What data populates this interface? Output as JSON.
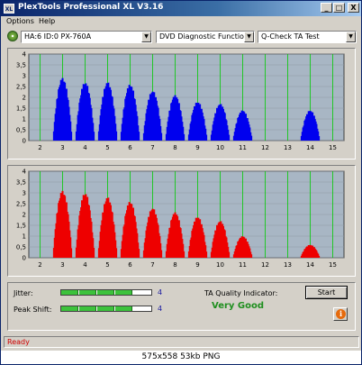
{
  "window": {
    "title": "PlexTools Professional XL V3.16",
    "icon_label": "XL",
    "minimize": "_",
    "maximize": "□",
    "close": "X"
  },
  "menu": {
    "items": [
      "Options",
      "Help"
    ]
  },
  "toolbar": {
    "drive": "HA:6 ID:0  PX-760A",
    "function": "DVD Diagnostic Functions",
    "test": "Q-Check TA Test"
  },
  "chart_data": [
    {
      "type": "bar",
      "name_hint": "top",
      "color": "#0000ee",
      "x_ticks": [
        "2",
        "3",
        "4",
        "5",
        "6",
        "7",
        "8",
        "9",
        "10",
        "11",
        "12",
        "13",
        "14",
        "15"
      ],
      "y_ticks": [
        "0",
        "0,5",
        "1",
        "1,5",
        "2",
        "2,5",
        "3",
        "3,5",
        "4"
      ],
      "xlim": [
        1.5,
        15.5
      ],
      "ylim": [
        0,
        4
      ],
      "grid_color": "#00cc00",
      "peaks": [
        {
          "x": 3,
          "y": 2.9
        },
        {
          "x": 4,
          "y": 2.7
        },
        {
          "x": 5,
          "y": 2.7
        },
        {
          "x": 6,
          "y": 2.6
        },
        {
          "x": 7,
          "y": 2.3
        },
        {
          "x": 8,
          "y": 2.1
        },
        {
          "x": 9,
          "y": 1.8
        },
        {
          "x": 10,
          "y": 1.7
        },
        {
          "x": 11,
          "y": 1.4
        },
        {
          "x": 14,
          "y": 1.4
        }
      ]
    },
    {
      "type": "bar",
      "name_hint": "bottom",
      "color": "#ee0000",
      "x_ticks": [
        "2",
        "3",
        "4",
        "5",
        "6",
        "7",
        "8",
        "9",
        "10",
        "11",
        "12",
        "13",
        "14",
        "15"
      ],
      "y_ticks": [
        "0",
        "0,5",
        "1",
        "1,5",
        "2",
        "2,5",
        "3",
        "3,5",
        "4"
      ],
      "xlim": [
        1.5,
        15.5
      ],
      "ylim": [
        0,
        4
      ],
      "grid_color": "#00cc00",
      "peaks": [
        {
          "x": 3,
          "y": 3.1
        },
        {
          "x": 4,
          "y": 3.0
        },
        {
          "x": 5,
          "y": 2.8
        },
        {
          "x": 6,
          "y": 2.6
        },
        {
          "x": 7,
          "y": 2.3
        },
        {
          "x": 8,
          "y": 2.1
        },
        {
          "x": 9,
          "y": 1.9
        },
        {
          "x": 10,
          "y": 1.7
        },
        {
          "x": 11,
          "y": 1.0
        },
        {
          "x": 14,
          "y": 0.6
        }
      ]
    }
  ],
  "results": {
    "jitter_label": "Jitter:",
    "jitter_value": "4",
    "jitter_level": 0.8,
    "peak_shift_label": "Peak Shift:",
    "peak_shift_value": "4",
    "peak_shift_level": 0.8,
    "ta_label": "TA Quality Indicator:",
    "ta_value": "Very Good"
  },
  "buttons": {
    "start": "Start",
    "info": "i"
  },
  "status": {
    "text": "Ready"
  },
  "caption": "575x558  53kb  PNG"
}
